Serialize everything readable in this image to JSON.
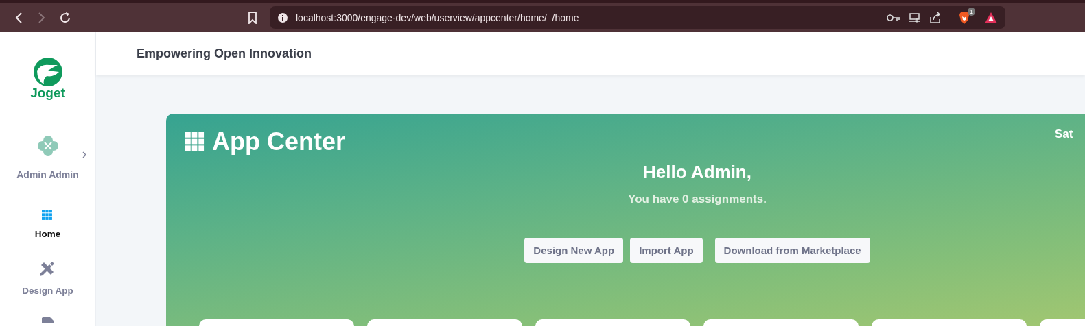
{
  "browser": {
    "url": "localhost:3000/engage-dev/web/userview/appcenter/home/_/home",
    "forward_disabled": true,
    "extension_badge": "1"
  },
  "sidebar": {
    "logo_text": "Joget",
    "user": {
      "name": "Admin Admin"
    },
    "items": [
      {
        "label": "Home",
        "kind": "home",
        "selected": true
      },
      {
        "label": "Design App",
        "kind": "design",
        "selected": false
      },
      {
        "kind": "tag",
        "selected": false
      }
    ]
  },
  "header": {
    "title": "Empowering Open Innovation"
  },
  "banner": {
    "title": "App Center",
    "date": "Sat",
    "greeting": "Hello Admin,",
    "assignments": "You have 0 assignments.",
    "buttons": [
      "Design New App",
      "Import App",
      "Download from Marketplace"
    ]
  }
}
